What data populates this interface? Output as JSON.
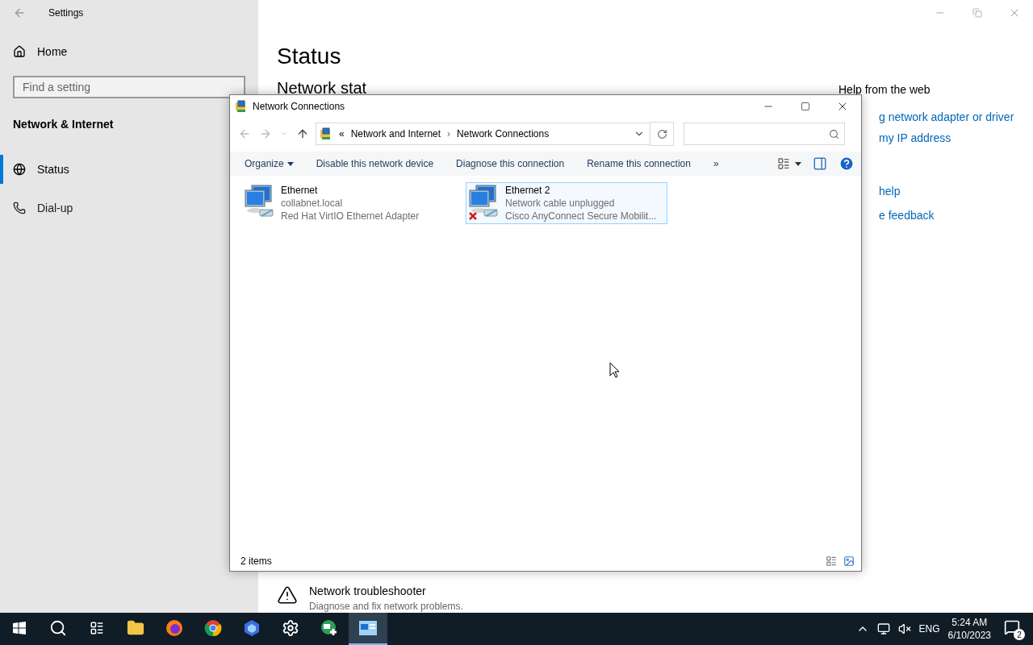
{
  "settings": {
    "title": "Settings",
    "home": "Home",
    "search": {
      "placeholder": "Find a setting"
    },
    "section": "Network & Internet",
    "nav": [
      {
        "label": "Status",
        "selected": true,
        "kind": "globe"
      },
      {
        "label": "Dial-up",
        "selected": false,
        "kind": "phone"
      }
    ],
    "page_title": "Status",
    "heading": "Network stat",
    "help": {
      "title": "Help from the web",
      "links": [
        "g network adapter or driver",
        "my IP address"
      ],
      "more_links": [
        "help",
        "e feedback"
      ]
    },
    "troubleshooter": {
      "title": "Network troubleshooter",
      "description": "Diagnose and fix network problems."
    }
  },
  "dialog": {
    "title": "Network Connections",
    "breadcrumb": {
      "overflow": "«",
      "items": [
        "Network and Internet",
        "Network Connections"
      ],
      "separator": "›"
    },
    "commands": [
      {
        "label": "Organize",
        "kind": "menu"
      },
      {
        "label": "Disable this network device",
        "kind": "button"
      },
      {
        "label": "Diagnose this connection",
        "kind": "button"
      },
      {
        "label": "Rename this connection",
        "kind": "button"
      },
      {
        "label": "»",
        "kind": "button"
      }
    ],
    "connections": [
      {
        "name": "Ethernet",
        "status": "collabnet.local",
        "adapter": "Red Hat VirtIO Ethernet Adapter",
        "selected": false,
        "disconnected": false
      },
      {
        "name": "Ethernet 2",
        "status": "Network cable unplugged",
        "adapter": "Cisco AnyConnect Secure Mobilit...",
        "selected": true,
        "disconnected": true
      }
    ],
    "status_bar": "2 items"
  },
  "taskbar": {
    "apps": [
      {
        "kind": "search",
        "active": false
      },
      {
        "kind": "taskview",
        "active": false
      },
      {
        "kind": "folder",
        "active": false
      },
      {
        "kind": "firefox",
        "active": false
      },
      {
        "kind": "chrome",
        "active": false
      },
      {
        "kind": "hexagon",
        "active": false
      },
      {
        "kind": "gear",
        "active": false
      },
      {
        "kind": "globeplus",
        "active": false
      },
      {
        "kind": "netconn",
        "active": true
      }
    ],
    "language": "ENG",
    "time": "5:24 AM",
    "date": "6/10/2023",
    "notifications": "2"
  }
}
